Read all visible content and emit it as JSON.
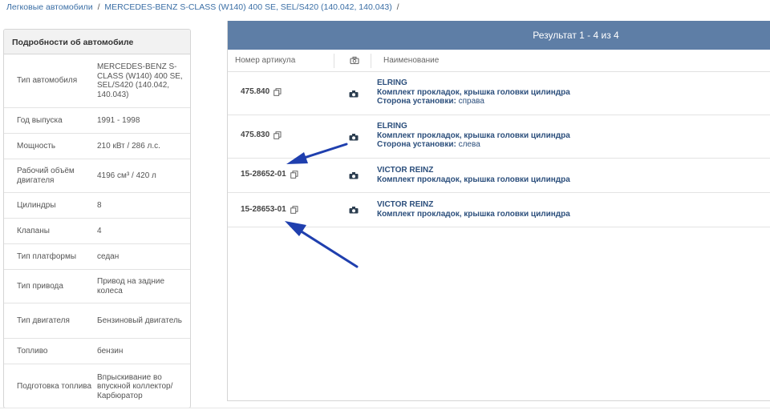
{
  "breadcrumb": {
    "item1": "Легковые автомобили",
    "sep1": "/",
    "item2": "MERCEDES-BENZ  S-CLASS (W140)  400 SE, SEL/S420 (140.042, 140.043)",
    "sep2": "/"
  },
  "details": {
    "title": "Подробности об автомобиле",
    "rows": [
      {
        "key": "Тип автомобиля",
        "value": "MERCEDES-BENZ S-CLASS (W140)  400 SE, SEL/S420 (140.042, 140.043)"
      },
      {
        "key": "Год выпуска",
        "value": "1991 - 1998"
      },
      {
        "key": "Мощность",
        "value": "210 кВт / 286 л.с."
      },
      {
        "key": "Рабочий объём двигателя",
        "value": "4196 см³ / 420 л"
      },
      {
        "key": "Цилиндры",
        "value": "8"
      },
      {
        "key": "Клапаны",
        "value": "4"
      },
      {
        "key": "Тип платформы",
        "value": "седан"
      },
      {
        "key": "Тип привода",
        "value": "Привод на задние колеса"
      },
      {
        "key": "Тип двигателя",
        "value": "Бензиновый двигатель"
      },
      {
        "key": "Топливо",
        "value": "бензин"
      },
      {
        "key": "Подготовка топлива",
        "value": "Впрыскивание во впускной коллектор/ Карбюратор"
      }
    ]
  },
  "results": {
    "header": "Результат 1 - 4 из 4",
    "col_article": "Номер артикула",
    "col_name": "Наименование",
    "rows": [
      {
        "article": "475.840",
        "brand": "ELRING",
        "desc": "Комплект прокладок, крышка головки цилиндра",
        "side_label": "Сторона установки:",
        "side_value": "справа"
      },
      {
        "article": "475.830",
        "brand": "ELRING",
        "desc": "Комплект прокладок, крышка головки цилиндра",
        "side_label": "Сторона установки:",
        "side_value": "слева"
      },
      {
        "article": "15-28652-01",
        "brand": "VICTOR REINZ",
        "desc": "Комплект прокладок, крышка головки цилиндра"
      },
      {
        "article": "15-28653-01",
        "brand": "VICTOR REINZ",
        "desc": "Комплект прокладок, крышка головки цилиндра"
      }
    ]
  },
  "colors": {
    "header_bg": "#5e7ea6",
    "link": "#3a6ea5",
    "name_text": "#2c4f7c",
    "arrow": "#1f3fae"
  },
  "icons": {
    "copy": "copy-icon",
    "camera": "camera-icon"
  }
}
